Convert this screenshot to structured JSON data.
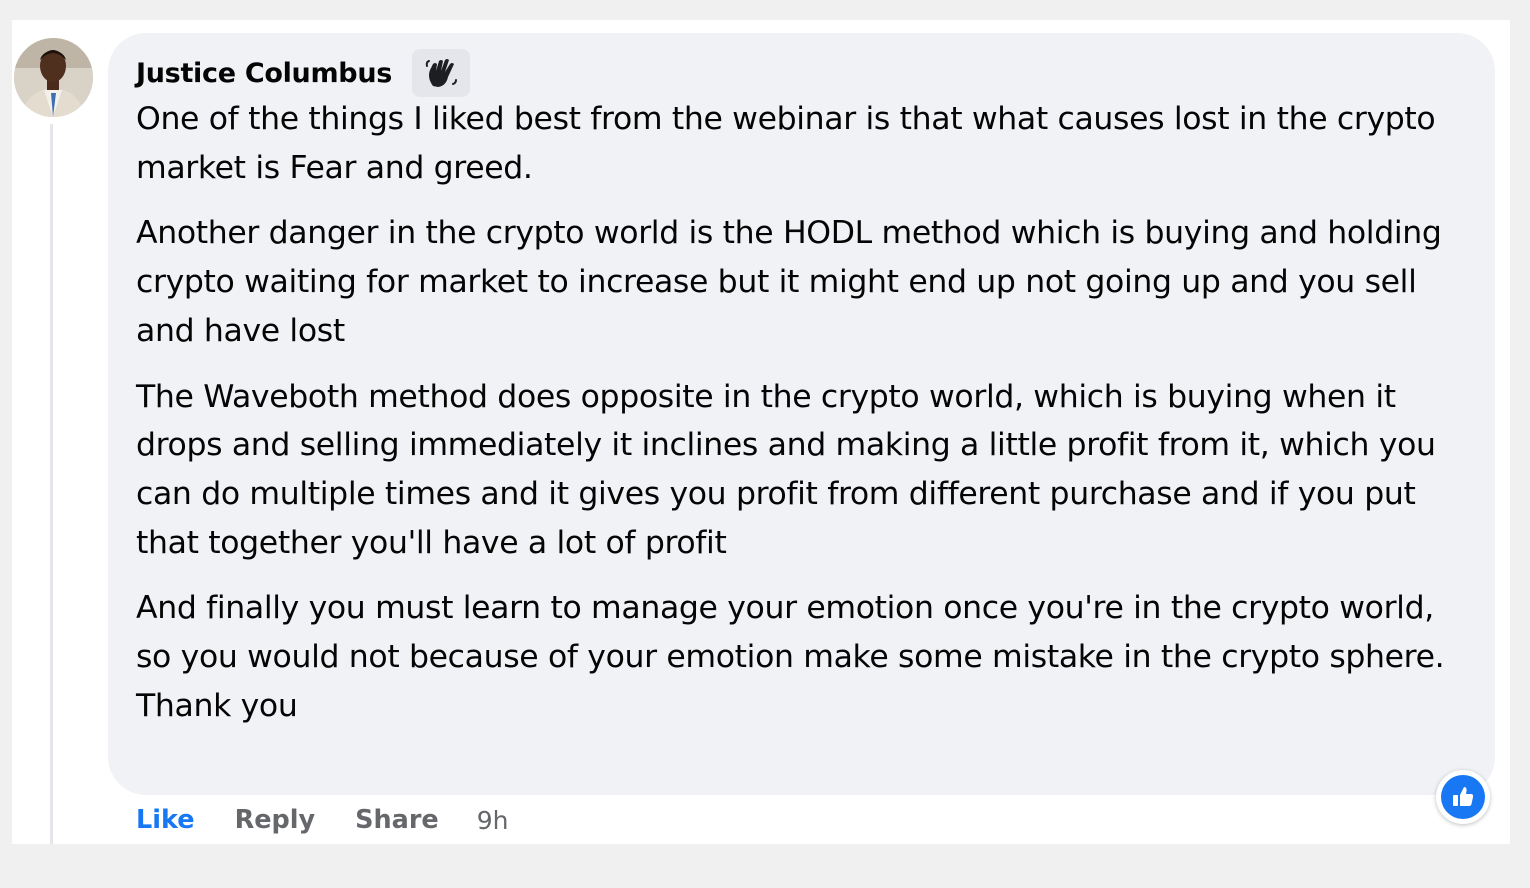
{
  "comment": {
    "author": "Justice Columbus",
    "badge_icon": "waving-hand-icon",
    "paragraphs": [
      "One of the things I liked best from the webinar is that what causes lost in the crypto market is Fear and greed.",
      "Another danger in the crypto world is the HODL method which is buying and holding crypto waiting for market to increase but it might end up not going up and you sell and have lost",
      "The Waveboth method does opposite in the crypto world, which is buying when it drops and selling immediately it inclines and making a little profit from it, which you can do multiple times and it gives you profit from different purchase and if you put that together you'll have a lot of profit",
      "And finally you must learn to manage your emotion once you're in the crypto world, so you would not because of your emotion make some mistake in the crypto sphere.",
      "Thank you"
    ],
    "actions": {
      "like": "Like",
      "reply": "Reply",
      "share": "Share",
      "time": "9h"
    },
    "reaction_icon": "like-thumb-icon"
  },
  "colors": {
    "bubble_background": "#f0f2f5",
    "like_blue": "#1877f2",
    "secondary_text": "#65676b",
    "primary_text": "#050505"
  }
}
